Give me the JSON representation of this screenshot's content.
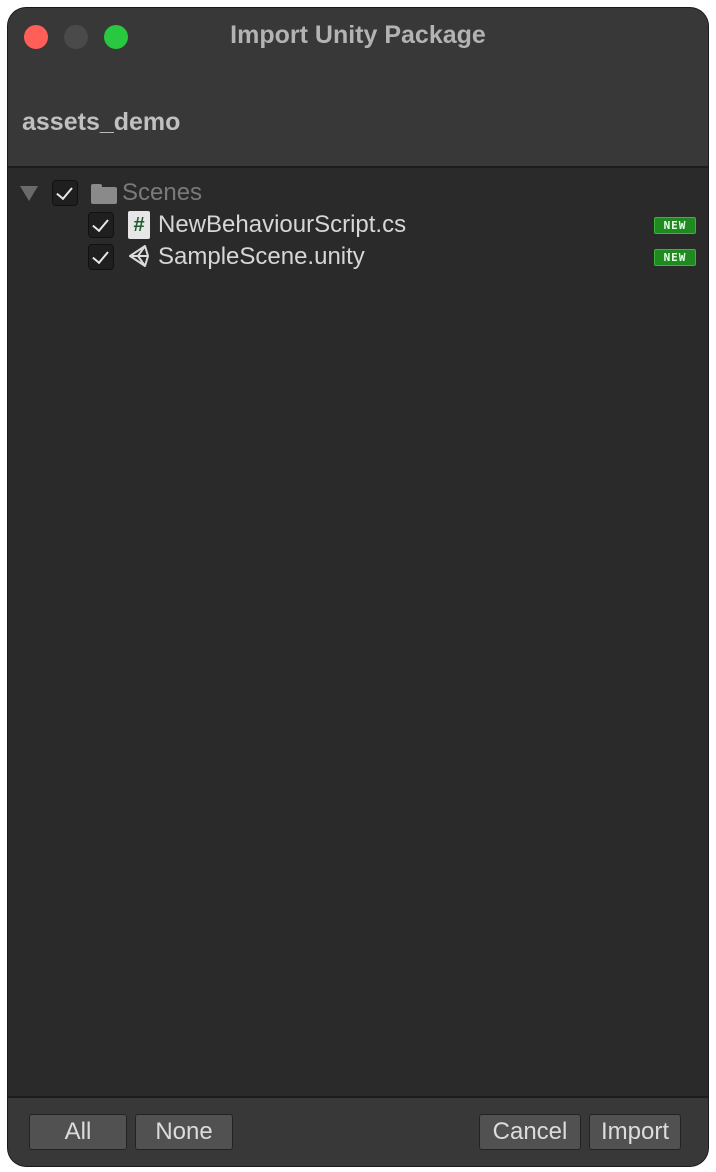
{
  "window": {
    "title": "Import Unity Package",
    "controls": [
      "close",
      "minimize",
      "maximize"
    ]
  },
  "package": {
    "name": "assets_demo"
  },
  "tree": {
    "folder": {
      "name": "Scenes",
      "checked": true,
      "expanded": true,
      "icon": "folder-icon"
    },
    "items": [
      {
        "name": "NewBehaviourScript.cs",
        "checked": true,
        "icon": "csharp-script-icon",
        "icon_glyph": "#",
        "badge": "NEW"
      },
      {
        "name": "SampleScene.unity",
        "checked": true,
        "icon": "unity-scene-icon",
        "badge": "NEW"
      }
    ]
  },
  "footer": {
    "all_label": "All",
    "none_label": "None",
    "cancel_label": "Cancel",
    "import_label": "Import"
  },
  "colors": {
    "window_bg": "#2a2a2a",
    "panel_bg": "#383838",
    "badge_green": "#1f8a1f",
    "close": "#ff5f57",
    "maximize": "#28c840"
  }
}
